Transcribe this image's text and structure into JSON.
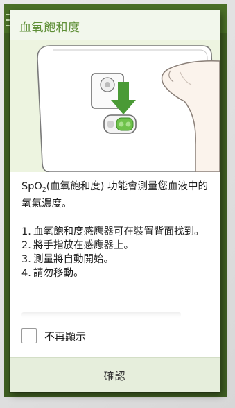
{
  "dialog": {
    "title": "血氧飽和度",
    "intro_prefix": "SpO",
    "intro_sub": "2",
    "intro_rest": "(血氧飽和度) 功能會測量您血液中的氧氣濃度。",
    "steps": [
      {
        "num": "1.",
        "text": "血氧飽和度感應器可在裝置背面找到。"
      },
      {
        "num": "2.",
        "text": "將手指放在感應器上。"
      },
      {
        "num": "3.",
        "text": "測量將自動開始。"
      },
      {
        "num": "4.",
        "text": "請勿移動。"
      }
    ],
    "checkbox_label": "不再顯示",
    "checkbox_checked": false,
    "confirm_label": "確認"
  },
  "illustration": {
    "icons": [
      "phone-back-icon",
      "finger-icon",
      "down-arrow-icon",
      "sensor-icon"
    ]
  },
  "colors": {
    "accent": "#5f8f37",
    "header_bg": "#f2f7ec",
    "button_bar_bg": "#e6eedc",
    "arrow": "#4a9a36",
    "sensor": "#6ec24a",
    "app_bg": "#3f5e22"
  }
}
